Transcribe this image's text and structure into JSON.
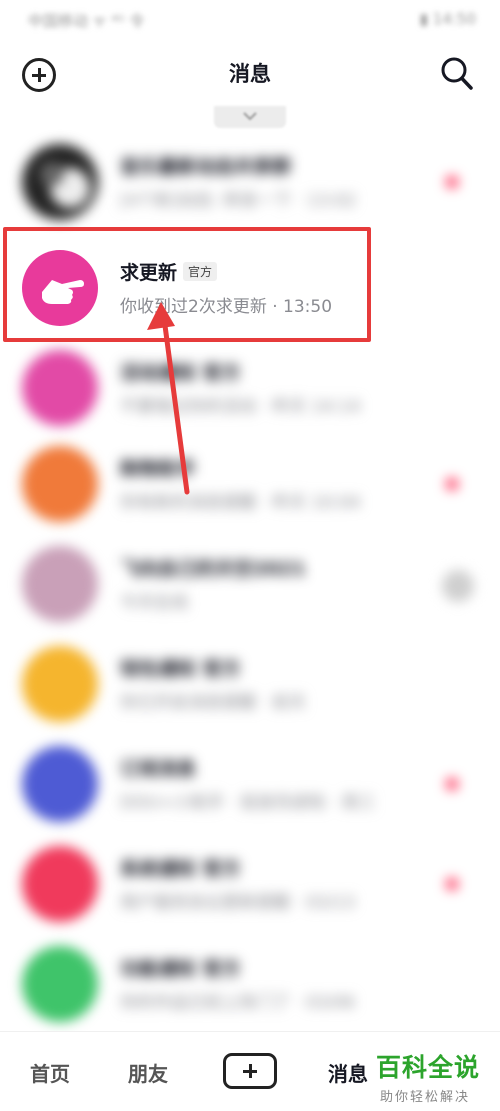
{
  "status_bar": {
    "left": "中国移动 ᯤ ⁴ᴳ 令",
    "right": "▮ 14:50"
  },
  "header": {
    "title": "消息"
  },
  "highlighted_item": {
    "name": "求更新",
    "badge": "官方",
    "subtitle": "你收到过2次求更新 · 13:50",
    "avatar_color": "#e83a9b"
  },
  "blurred_items": [
    {
      "name": "音乐最新动态共享群",
      "subtitle": "[4个新]动态: 转发一下 · 13:02",
      "avatar_color": "#222222",
      "unread": true
    },
    {
      "name": "活动通知 官方",
      "subtitle": "不要错过你的活动 · 昨天 14:14",
      "avatar_color": "#e24aa6",
      "unread": false
    },
    {
      "name": "购物助手",
      "subtitle": "你有新的消息提醒 · 昨天 10:04",
      "avatar_color": "#f07a3a",
      "unread": true
    },
    {
      "name": "飞向自己的天空2021",
      "subtitle": "今天在线",
      "avatar_color": "#c9a0b8",
      "unread": false
    },
    {
      "name": "钱包通知 官方",
      "subtitle": "你已开启消息提醒 · 前天",
      "avatar_color": "#f5b52e",
      "unread": false
    },
    {
      "name": "订阅消息",
      "subtitle": "DOU+小助手 · 投放完成啦 · 周三",
      "avatar_color": "#4e5bd4",
      "unread": true
    },
    {
      "name": "系统通知 官方",
      "subtitle": "用户服务协议更新提醒 · 03/13",
      "avatar_color": "#f03a5c",
      "unread": true
    },
    {
      "name": "功能通知 官方",
      "subtitle": "你的作品已经上热门了 · 03/06",
      "avatar_color": "#3fc46a",
      "unread": false
    }
  ],
  "tabbar": {
    "home": "首页",
    "friends": "朋友",
    "messages": "消息"
  },
  "watermark": {
    "title": "百科全说",
    "subtitle": "助你轻松解决"
  },
  "colors": {
    "accent": "#fe2c55",
    "annotation": "#e63b3b",
    "watermark": "#2ca42c"
  }
}
